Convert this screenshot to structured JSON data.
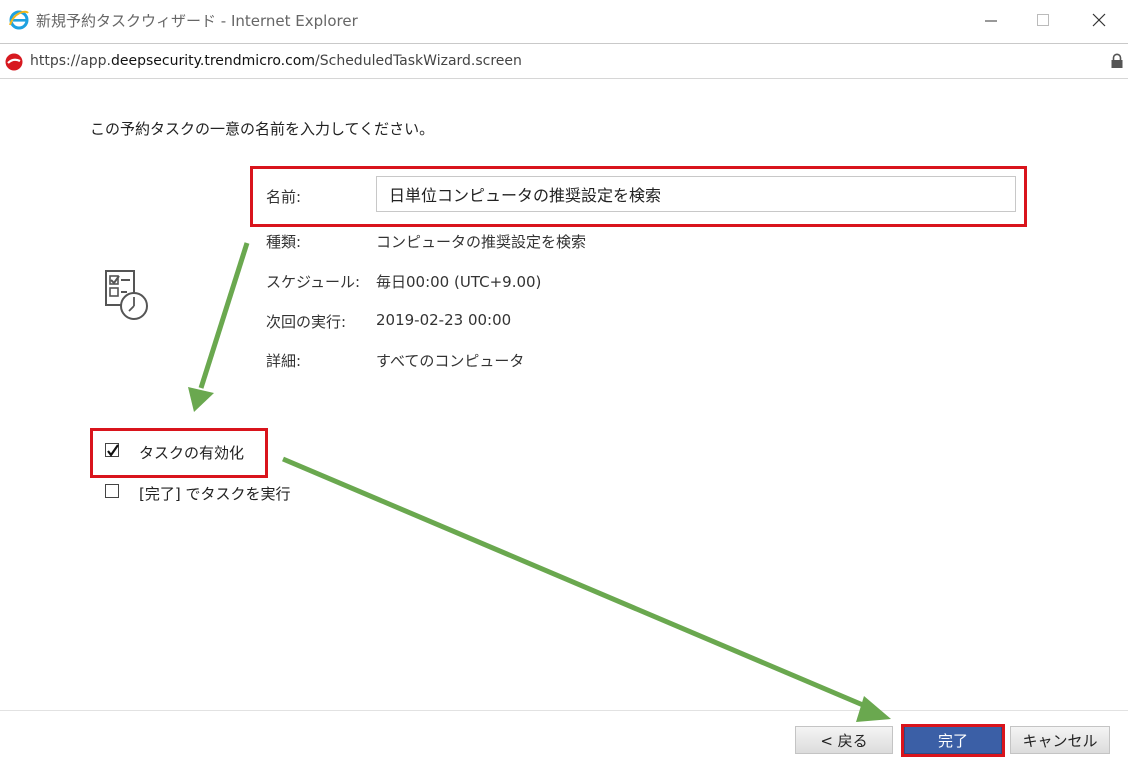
{
  "window": {
    "title": "新規予約タスクウィザード - Internet Explorer",
    "icon": "ie-icon",
    "controls": [
      "minimize",
      "maximize",
      "close"
    ]
  },
  "address": {
    "scheme": "https://",
    "host_prefix": "app.",
    "host_main": "deepsecurity.trendmicro.com",
    "path": "/ScheduledTaskWizard.screen",
    "lock": "lock-icon"
  },
  "wizard": {
    "instruction": "この予約タスクの一意の名前を入力してください。",
    "name_label": "名前:",
    "name_value": "日単位コンピュータの推奨設定を検索",
    "type_label": "種類:",
    "type_value": "コンピュータの推奨設定を検索",
    "schedule_label": "スケジュール:",
    "schedule_value": "毎日00:00 (UTC+9.00)",
    "next_run_label": "次回の実行:",
    "next_run_value": "2019-02-23 00:00",
    "details_label": "詳細:",
    "details_value": "すべてのコンピュータ",
    "enable_task_label": "タスクの有効化",
    "enable_task_checked": true,
    "run_on_finish_label": "[完了] でタスクを実行",
    "run_on_finish_checked": false
  },
  "buttons": {
    "back": "< 戻る",
    "finish": "完了",
    "cancel": "キャンセル"
  },
  "annotations": {
    "highlight_color": "#d9141c",
    "arrow_color": "#6aa84f"
  }
}
